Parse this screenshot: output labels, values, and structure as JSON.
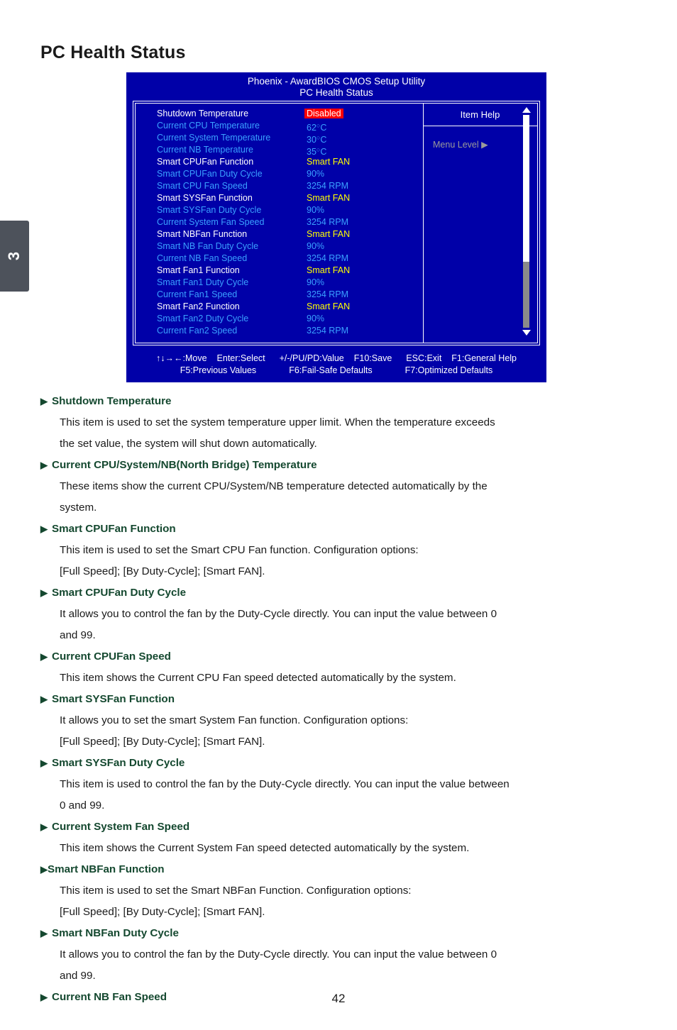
{
  "chapter_tab": {
    "number": "3"
  },
  "page_title": "PC Health Status",
  "page_number": "42",
  "bios": {
    "title_line1": "Phoenix - AwardBIOS CMOS Setup Utility",
    "title_line2": "PC Health Status",
    "rows": [
      {
        "label": "Shutdown Temperature",
        "value": "Disabled",
        "label_color": "white",
        "value_style": "highlight"
      },
      {
        "label": "Current CPU Temperature",
        "value": "62",
        "label_color": "blue",
        "value_style": "temp"
      },
      {
        "label": "Current System Temperature",
        "value": "30",
        "label_color": "blue",
        "value_style": "temp"
      },
      {
        "label": "Current NB Temperature",
        "value": "35",
        "label_color": "blue",
        "value_style": "temp"
      },
      {
        "label": "Smart CPUFan Function",
        "value": "Smart FAN",
        "label_color": "white",
        "value_style": "yellow"
      },
      {
        "label": "Smart CPUFan Duty Cycle",
        "value": "90%",
        "label_color": "blue",
        "value_style": "blue"
      },
      {
        "label": "Smart CPU Fan Speed",
        "value": "3254 RPM",
        "label_color": "blue",
        "value_style": "blue"
      },
      {
        "label": "Smart SYSFan Function",
        "value": "Smart FAN",
        "label_color": "white",
        "value_style": "yellow"
      },
      {
        "label": "Smart SYSFan Duty Cycle",
        "value": "90%",
        "label_color": "blue",
        "value_style": "blue"
      },
      {
        "label": "Current System Fan Speed",
        "value": "3254 RPM",
        "label_color": "blue",
        "value_style": "blue"
      },
      {
        "label": "Smart NBFan Function",
        "value": "Smart FAN",
        "label_color": "white",
        "value_style": "yellow"
      },
      {
        "label": "Smart NB Fan Duty Cycle",
        "value": "90%",
        "label_color": "blue",
        "value_style": "blue"
      },
      {
        "label": "Current NB Fan Speed",
        "value": "3254 RPM",
        "label_color": "blue",
        "value_style": "blue"
      },
      {
        "label": "Smart Fan1 Function",
        "value": "Smart FAN",
        "label_color": "white",
        "value_style": "yellow"
      },
      {
        "label": "Smart Fan1 Duty Cycle",
        "value": "90%",
        "label_color": "blue",
        "value_style": "blue"
      },
      {
        "label": "Current Fan1 Speed",
        "value": "3254 RPM",
        "label_color": "blue",
        "value_style": "blue"
      },
      {
        "label": "Smart Fan2 Function",
        "value": "Smart FAN",
        "label_color": "white",
        "value_style": "yellow"
      },
      {
        "label": "Smart Fan2 Duty Cycle",
        "value": "90%",
        "label_color": "blue",
        "value_style": "blue"
      },
      {
        "label": "Current Fan2 Speed",
        "value": "3254 RPM",
        "label_color": "blue",
        "value_style": "blue"
      }
    ],
    "help": {
      "title": "Item Help",
      "menu_level": "Menu Level  ▶"
    },
    "scrollbar": {
      "up_arrow": "▲",
      "down_arrow": "▼"
    },
    "footer": {
      "move": "↑↓→←:Move",
      "select": "Enter:Select",
      "value": "+/-/PU/PD:Value",
      "save": "F10:Save",
      "exit": "ESC:Exit",
      "general_help": "F1:General Help",
      "previous_values": "F5:Previous Values",
      "fail_safe": "F6:Fail-Safe Defaults",
      "optimized": "F7:Optimized Defaults"
    },
    "colors": {
      "background": "#0000a8",
      "label_white": "#ffffff",
      "label_blue": "#3aa0ff",
      "value_yellow": "#ffff00",
      "highlight_bg": "#ff0000",
      "help_gray": "#9a9a9a"
    }
  },
  "sections": [
    {
      "heading": "Shutdown Temperature",
      "tight": false,
      "paragraphs": [
        "This item is used to set the system temperature upper limit. When the temperature exceeds",
        "the set value, the system will shut down automatically."
      ]
    },
    {
      "heading": "Current CPU/System/NB(North Bridge) Temperature",
      "tight": false,
      "paragraphs": [
        "These items show the current CPU/System/NB temperature detected automatically by the",
        "system."
      ]
    },
    {
      "heading": "Smart CPUFan Function",
      "tight": false,
      "paragraphs": [
        "This item is used to set the Smart CPU Fan function. Configuration options:",
        "[Full Speed]; [By Duty-Cycle]; [Smart FAN]."
      ]
    },
    {
      "heading": "Smart CPUFan Duty Cycle",
      "tight": false,
      "paragraphs": [
        "It allows you to control the fan by the Duty-Cycle directly. You can input the value between 0",
        "and 99."
      ]
    },
    {
      "heading": "Current CPUFan Speed",
      "tight": false,
      "paragraphs": [
        "This item shows the Current CPU Fan speed detected automatically by the system."
      ]
    },
    {
      "heading": "Smart SYSFan Function",
      "tight": false,
      "paragraphs": [
        "It allows you to set the smart System Fan function. Configuration options:",
        "[Full Speed]; [By Duty-Cycle]; [Smart FAN]."
      ]
    },
    {
      "heading": "Smart SYSFan Duty Cycle",
      "tight": false,
      "paragraphs": [
        "This item is used to control the fan by the Duty-Cycle directly. You can input the value between",
        "0 and 99."
      ]
    },
    {
      "heading": "Current System Fan Speed",
      "tight": false,
      "paragraphs": [
        "This item shows the Current System Fan speed detected automatically by the system."
      ]
    },
    {
      "heading": "Smart NBFan Function",
      "tight": true,
      "paragraphs": [
        "This item is used to set the Smart NBFan Function. Configuration options:",
        "[Full Speed]; [By Duty-Cycle]; [Smart FAN]."
      ]
    },
    {
      "heading": "Smart NBFan Duty Cycle",
      "tight": false,
      "paragraphs": [
        "It allows you to control the fan by the Duty-Cycle directly. You can input the value between 0",
        "and 99."
      ]
    },
    {
      "heading": "Current NB Fan Speed",
      "tight": false,
      "paragraphs": []
    }
  ]
}
